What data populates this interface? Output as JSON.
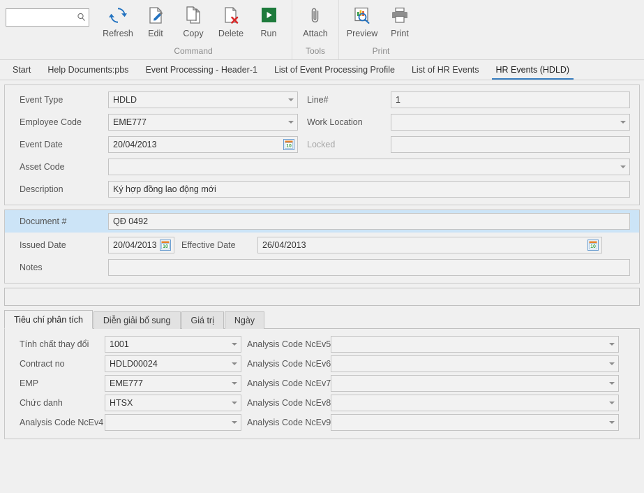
{
  "ribbon": {
    "search": {
      "value": "",
      "placeholder": ""
    },
    "groups": [
      {
        "title": "Command",
        "items": [
          {
            "label": "Refresh",
            "icon": "refresh-icon"
          },
          {
            "label": "Edit",
            "icon": "edit-icon"
          },
          {
            "label": "Copy",
            "icon": "copy-icon"
          },
          {
            "label": "Delete",
            "icon": "delete-icon"
          },
          {
            "label": "Run",
            "icon": "run-icon"
          }
        ]
      },
      {
        "title": "Tools",
        "items": [
          {
            "label": "Attach",
            "icon": "paperclip-icon"
          }
        ]
      },
      {
        "title": "Print",
        "items": [
          {
            "label": "Preview",
            "icon": "print-preview-icon"
          },
          {
            "label": "Print",
            "icon": "printer-icon"
          }
        ]
      }
    ]
  },
  "document_tabs": [
    {
      "label": "Start",
      "active": false
    },
    {
      "label": "Help Documents:pbs",
      "active": false
    },
    {
      "label": "Event Processing - Header-1",
      "active": false
    },
    {
      "label": "List of Event Processing Profile",
      "active": false
    },
    {
      "label": "List of HR Events",
      "active": false
    },
    {
      "label": "HR Events (HDLD)",
      "active": true
    }
  ],
  "header_panel": {
    "event_type": {
      "label": "Event Type",
      "value": "HDLD"
    },
    "line_no": {
      "label": "Line#",
      "value": "1"
    },
    "employee_code": {
      "label": "Employee Code",
      "value": "EME777"
    },
    "work_location": {
      "label": "Work Location",
      "value": ""
    },
    "event_date": {
      "label": "Event Date",
      "value": "20/04/2013"
    },
    "locked": {
      "label": "Locked",
      "value": ""
    },
    "asset_code": {
      "label": "Asset Code",
      "value": ""
    },
    "description": {
      "label": "Description",
      "value": "Ký hợp đồng lao động mới"
    }
  },
  "document_panel": {
    "document_no": {
      "label": "Document #",
      "value": "QĐ 0492"
    },
    "issued_date": {
      "label": "Issued Date",
      "value": "20/04/2013"
    },
    "effective_date": {
      "label": "Effective Date",
      "value": "26/04/2013"
    },
    "notes": {
      "label": "Notes",
      "value": ""
    }
  },
  "spacer_field": {
    "value": ""
  },
  "inner_tabs": [
    {
      "label": "Tiêu chí phân tích",
      "active": true
    },
    {
      "label": "Diễn giải bổ sung",
      "active": false
    },
    {
      "label": "Giá trị",
      "active": false
    },
    {
      "label": "Ngày",
      "active": false
    }
  ],
  "analysis": {
    "left": [
      {
        "label": "Tính chất thay đổi",
        "value": "1001"
      },
      {
        "label": "Contract no",
        "value": "HDLD00024"
      },
      {
        "label": "EMP",
        "value": "EME777"
      },
      {
        "label": "Chức danh",
        "value": "HTSX"
      },
      {
        "label": "Analysis Code NcEv4",
        "value": ""
      }
    ],
    "right": [
      {
        "label": "Analysis Code NcEv5",
        "value": ""
      },
      {
        "label": "Analysis Code NcEv6",
        "value": ""
      },
      {
        "label": "Analysis Code NcEv7",
        "value": ""
      },
      {
        "label": "Analysis Code NcEv8",
        "value": ""
      },
      {
        "label": "Analysis Code NcEv9",
        "value": ""
      }
    ]
  },
  "colors": {
    "accent_blue": "#3a7fc1",
    "highlight_blue": "#cce4f7",
    "run_green": "#1e7b3c",
    "delete_red": "#d92b2b",
    "panel_bg": "#f0f0f0"
  }
}
